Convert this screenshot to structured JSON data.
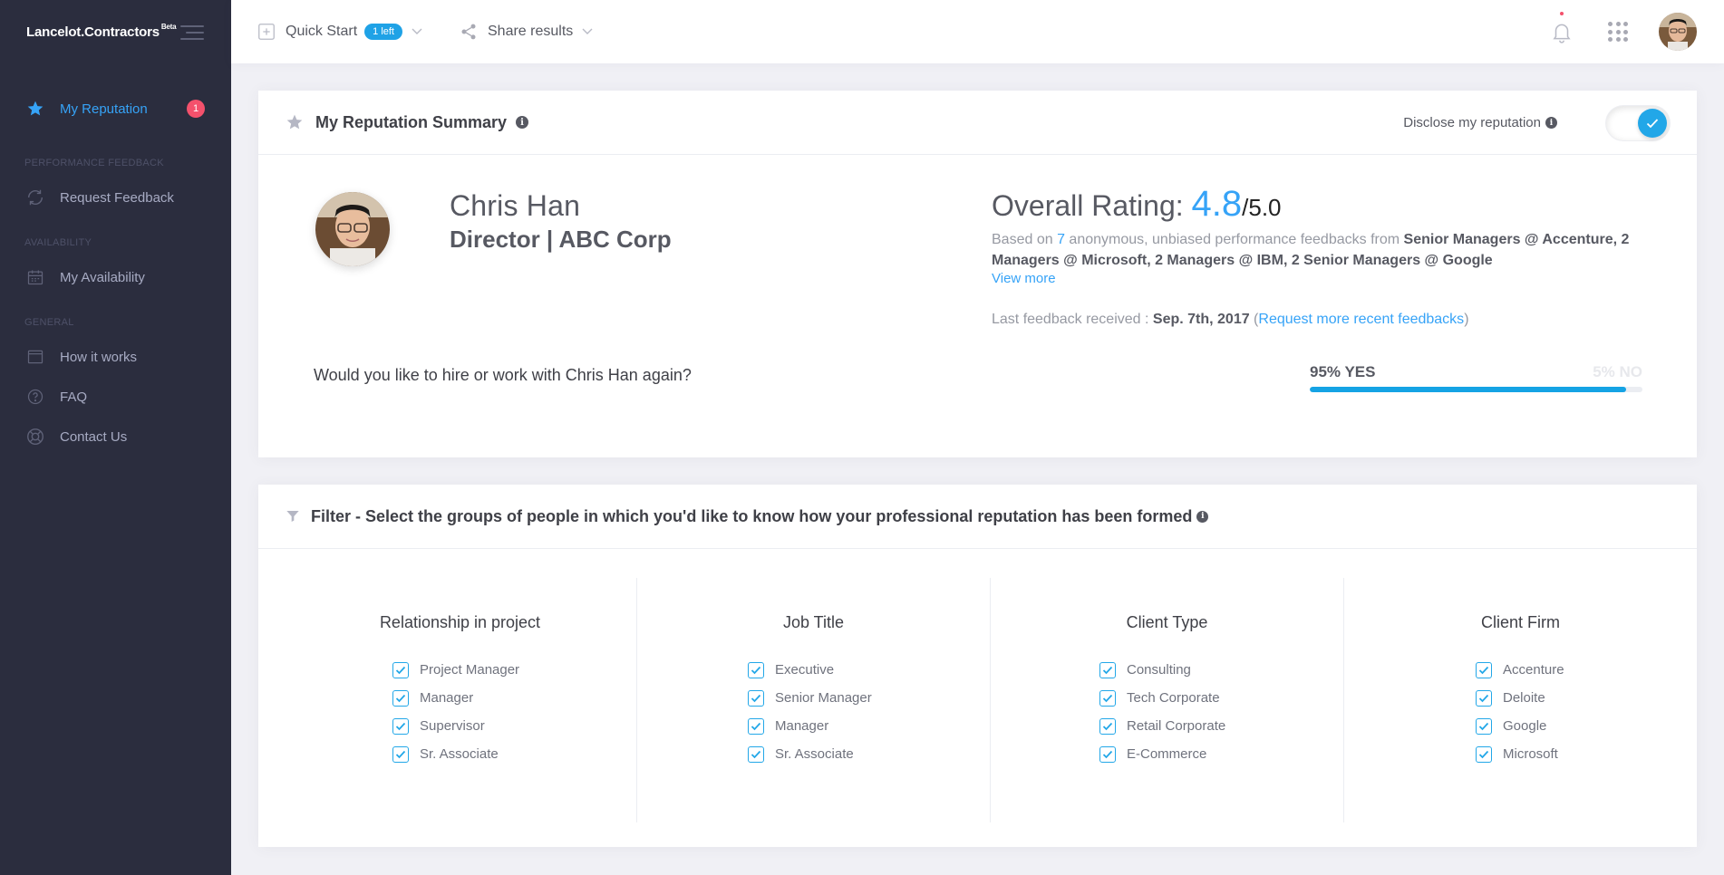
{
  "app": {
    "brand": "Lancelot.Contractors",
    "brand_badge": "Beta"
  },
  "sidebar": {
    "items": [
      {
        "label": "My Reputation",
        "badge": "1",
        "active": true,
        "icon": "star-icon"
      }
    ],
    "sections": [
      {
        "title": "PERFORMANCE FEEDBACK",
        "items": [
          {
            "label": "Request Feedback",
            "icon": "refresh-icon"
          }
        ]
      },
      {
        "title": "AVAILABILITY",
        "items": [
          {
            "label": "My Availability",
            "icon": "calendar-icon"
          }
        ]
      },
      {
        "title": "GENERAL",
        "items": [
          {
            "label": "How it works",
            "icon": "browser-icon"
          },
          {
            "label": "FAQ",
            "icon": "question-icon"
          },
          {
            "label": "Contact Us",
            "icon": "lifebuoy-icon"
          }
        ]
      }
    ]
  },
  "topbar": {
    "quick_start": "Quick Start",
    "quick_start_badge": "1 left",
    "share": "Share results"
  },
  "summary": {
    "title": "My Reputation Summary",
    "disclose_label": "Disclose my reputation",
    "disclose_on": true,
    "name": "Chris Han",
    "position": "Director | ABC Corp",
    "rating_label": "Overall Rating:",
    "rating_value": "4.8",
    "rating_max": "/5.0",
    "based_prefix": "Based on",
    "based_count": "7",
    "based_mid": "anonymous, unbiased performance feedbacks from",
    "based_from": "Senior Managers @ Accenture, 2 Managers @ Microsoft, 2 Managers @ IBM, 2 Senior Managers @ Google",
    "view_more": "View more",
    "last_label": "Last feedback received :",
    "last_date": "Sep. 7th, 2017",
    "request_more": "Request more recent feedbacks",
    "question": "Would you like to hire or work with Chris Han again?",
    "yes_label": "95% YES",
    "no_label": "5% NO",
    "yes_fraction": 0.95
  },
  "filter": {
    "title": "Filter - Select the groups of people in which you'd like to know how your professional reputation has been formed",
    "columns": [
      {
        "title": "Relationship in project",
        "options": [
          "Project Manager",
          "Manager",
          "Supervisor",
          "Sr. Associate"
        ]
      },
      {
        "title": "Job Title",
        "options": [
          "Executive",
          "Senior Manager",
          "Manager",
          "Sr. Associate"
        ]
      },
      {
        "title": "Client Type",
        "options": [
          "Consulting",
          "Tech Corporate",
          "Retail Corporate",
          "E-Commerce"
        ]
      },
      {
        "title": "Client Firm",
        "options": [
          "Accenture",
          "Deloite",
          "Google",
          "Microsoft"
        ]
      }
    ]
  },
  "colors": {
    "accent": "#36a3f7",
    "sidebar_bg": "#2b2d3e",
    "badge": "#f4516c"
  }
}
